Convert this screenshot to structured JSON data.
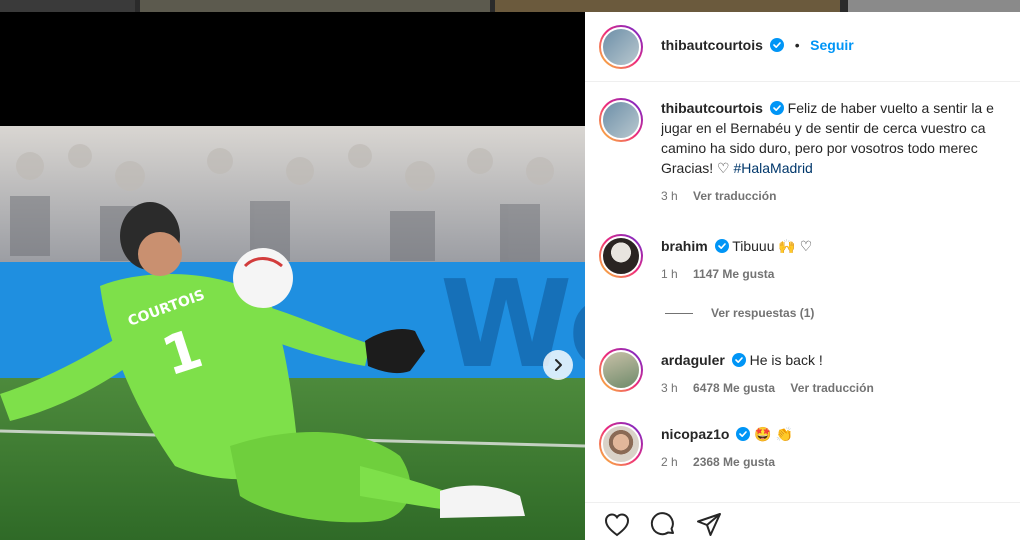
{
  "post": {
    "author": "thibautcourtois",
    "follow_label": "Seguir",
    "separator": "•"
  },
  "caption": {
    "username": "thibautcourtois",
    "lines": [
      "Feliz de haber vuelto a sentir la e",
      "jugar en el Bernabéu y de sentir de cerca vuestro ca",
      "camino ha sido duro, pero por vosotros todo merec",
      "Gracias! ♡ "
    ],
    "hashtag": "#HalaMadrid",
    "time": "3 h",
    "translate_label": "Ver traducción"
  },
  "comments": [
    {
      "username": "brahim",
      "text": "Tibuuu 🙌 ♡",
      "time": "1 h",
      "likes": "1147 Me gusta",
      "translate": ""
    },
    {
      "username": "ardaguler",
      "text": "He is back !",
      "time": "3 h",
      "likes": "6478 Me gusta",
      "translate": "Ver traducción"
    },
    {
      "username": "nicopaz1o",
      "text": "🤩 👏",
      "time": "2 h",
      "likes": "2368 Me gusta",
      "translate": ""
    }
  ],
  "replies_label": "Ver respuestas (1)",
  "icons": {
    "like": "heart-icon",
    "comment": "comment-icon",
    "share": "send-icon",
    "verified": "verified-badge-icon",
    "next": "chevron-right-icon"
  },
  "colors": {
    "follow": "#0095f6",
    "verified": "#0095f6",
    "hashtag": "#00376b",
    "muted": "#737373",
    "jersey": "#7ee04a",
    "board": "#1f8fe0"
  }
}
